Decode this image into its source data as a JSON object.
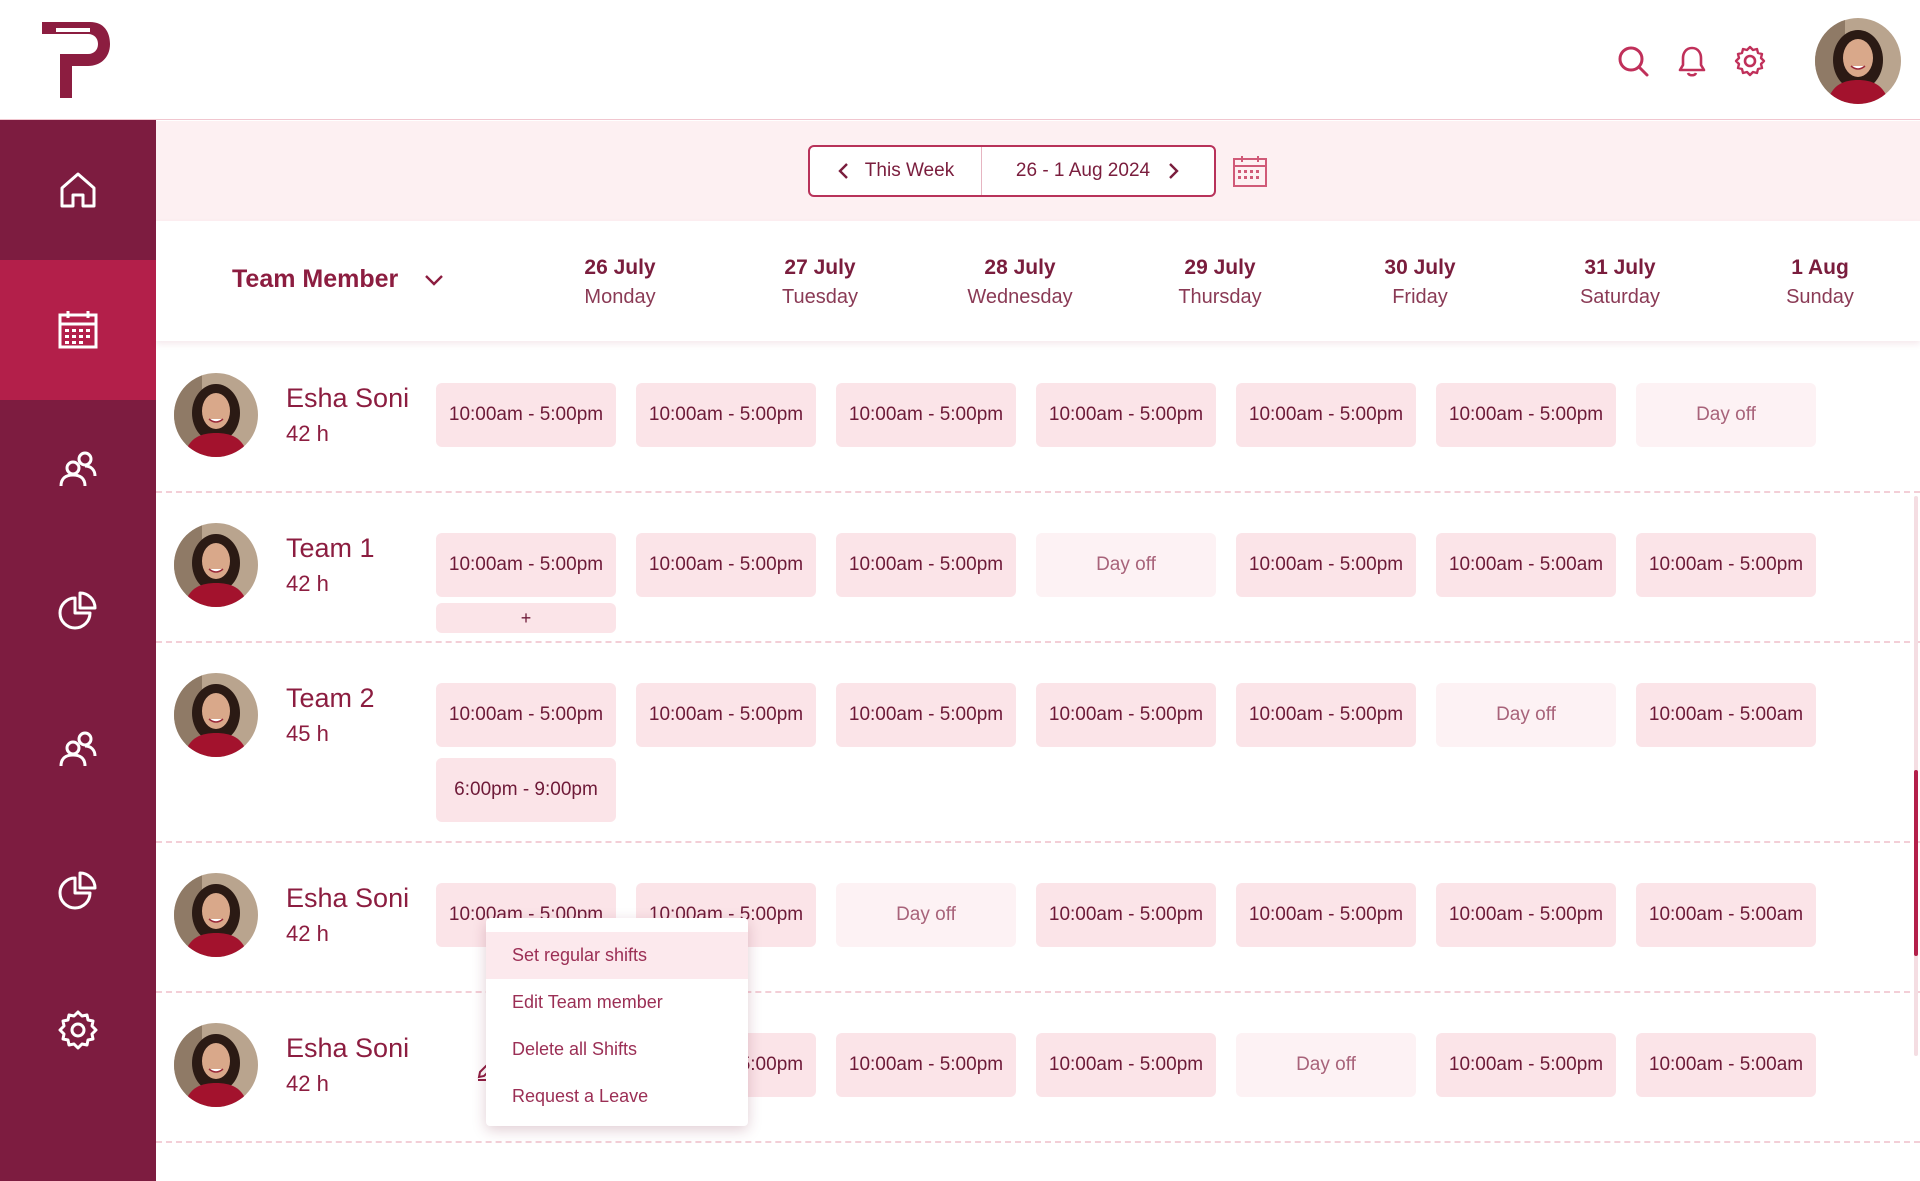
{
  "header": {
    "logo_icon": "P-logo",
    "icons": [
      "search-icon",
      "bell-icon",
      "gear-icon"
    ],
    "accent_color": "#8c1d40"
  },
  "sidebar": {
    "items": [
      {
        "icon": "home-icon",
        "active": false
      },
      {
        "icon": "calendar-icon",
        "active": true
      },
      {
        "icon": "users-icon",
        "active": false
      },
      {
        "icon": "pie-chart-icon",
        "active": false
      },
      {
        "icon": "users-icon",
        "active": false
      },
      {
        "icon": "pie-chart-icon",
        "active": false
      },
      {
        "icon": "gear-icon",
        "active": false
      }
    ]
  },
  "week_nav": {
    "label": "This Week",
    "range": "26 - 1 Aug 2024"
  },
  "columns": {
    "team_member_label": "Team Member",
    "days": [
      {
        "date": "26 July",
        "name": "Monday"
      },
      {
        "date": "27 July",
        "name": "Tuesday"
      },
      {
        "date": "28 July",
        "name": "Wednesday"
      },
      {
        "date": "29 July",
        "name": "Thursday"
      },
      {
        "date": "30 July",
        "name": "Friday"
      },
      {
        "date": "31 July",
        "name": "Saturday"
      },
      {
        "date": "1 Aug",
        "name": "Sunday"
      }
    ]
  },
  "rows": [
    {
      "name": "Esha Soni",
      "hours": "42 h",
      "shifts": [
        "10:00am - 5:00pm",
        "10:00am - 5:00pm",
        "10:00am - 5:00pm",
        "10:00am - 5:00pm",
        "10:00am - 5:00pm",
        "10:00am - 5:00pm",
        "Day off"
      ]
    },
    {
      "name": "Team 1",
      "hours": "42 h",
      "shifts": [
        "10:00am - 5:00pm",
        "10:00am - 5:00pm",
        "10:00am - 5:00pm",
        "Day off",
        "10:00am - 5:00pm",
        "10:00am - 5:00am",
        "10:00am - 5:00pm"
      ],
      "add_label": "+"
    },
    {
      "name": "Team 2",
      "hours": "45 h",
      "shifts": [
        "10:00am - 5:00pm",
        "10:00am - 5:00pm",
        "10:00am - 5:00pm",
        "10:00am - 5:00pm",
        "10:00am - 5:00pm",
        "Day off",
        "10:00am - 5:00am"
      ],
      "extra_shift": "6:00pm - 9:00pm"
    },
    {
      "name": "Esha Soni",
      "hours": "42 h",
      "shifts": [
        "10:00am - 5:00pm",
        "10:00am - 5:00pm",
        "Day off",
        "10:00am - 5:00pm",
        "10:00am - 5:00pm",
        "10:00am - 5:00pm",
        "10:00am - 5:00am"
      ]
    },
    {
      "name": "Esha Soni",
      "hours": "42 h",
      "shifts": [
        "",
        "10:00am - 5:00pm",
        "10:00am - 5:00pm",
        "10:00am - 5:00pm",
        "Day off",
        "10:00am - 5:00pm",
        "10:00am - 5:00am"
      ]
    }
  ],
  "context_menu": {
    "items": [
      "Set regular shifts",
      "Edit Team member",
      "Delete all Shifts",
      "Request a Leave"
    ]
  }
}
